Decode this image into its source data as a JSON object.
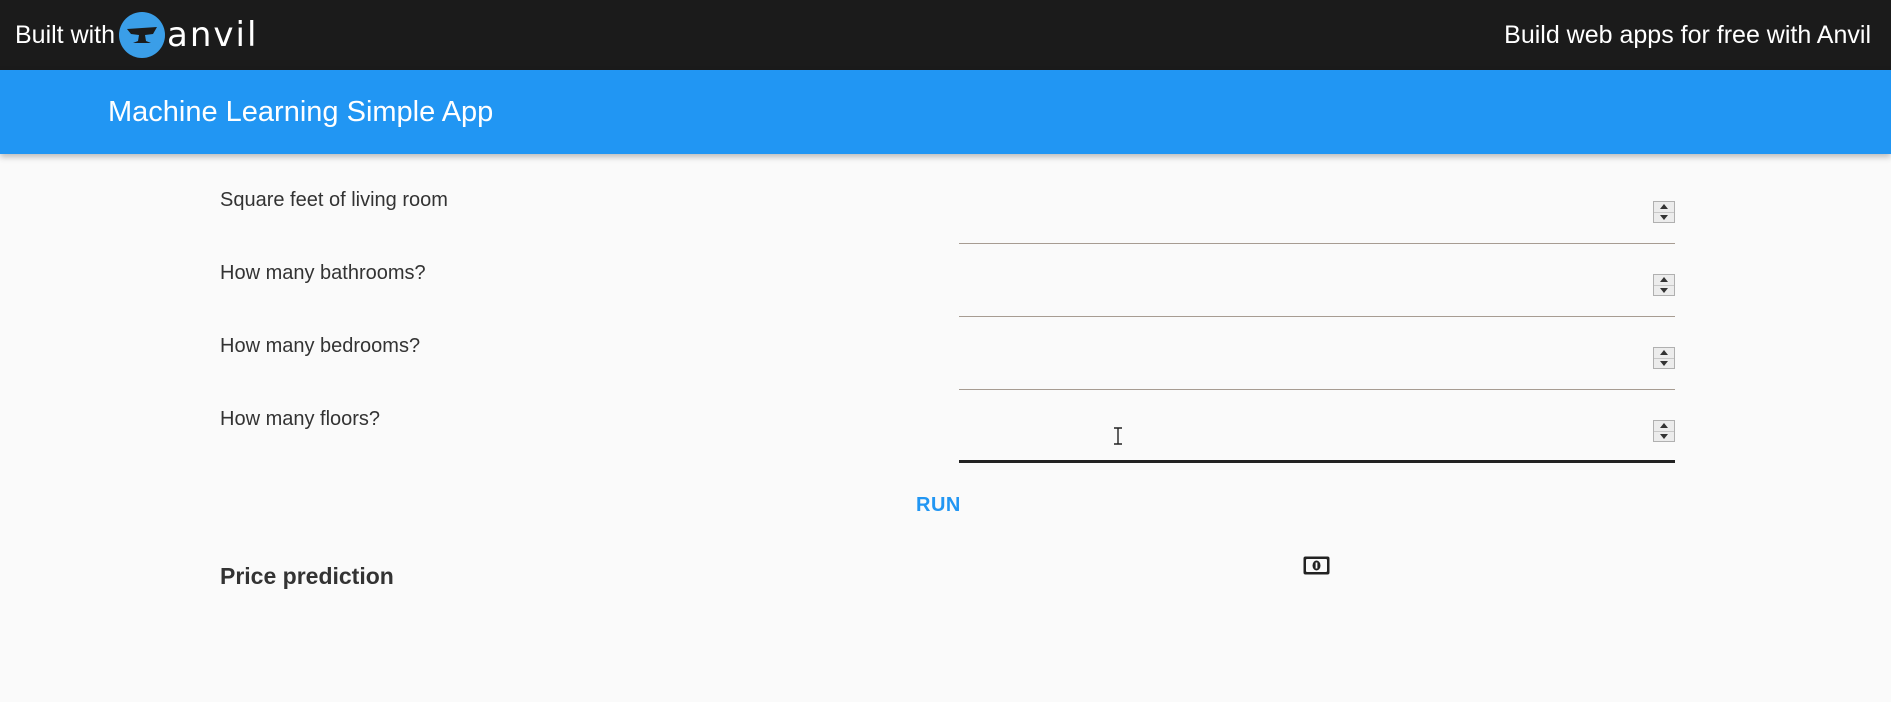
{
  "topbar": {
    "built_with": "Built with",
    "brand": "anvil",
    "promo": "Build web apps for free with Anvil",
    "bg_color": "#1b1b1b",
    "logo_color": "#3a9ee8"
  },
  "appbar": {
    "title": "Machine Learning Simple App",
    "bg_color": "#2196f3"
  },
  "form": {
    "fields": [
      {
        "label": "Square feet of living room",
        "value": "",
        "focused": false
      },
      {
        "label": "How many bathrooms?",
        "value": "",
        "focused": false
      },
      {
        "label": "How many bedrooms?",
        "value": "",
        "focused": false
      },
      {
        "label": "How many floors?",
        "value": "",
        "focused": true
      }
    ],
    "run_label": "RUN",
    "result_label": "Price prediction",
    "result_icon": "money-icon"
  },
  "icons": {
    "logo": "anvil-logo-icon",
    "spinner_up": "spinner-up-icon",
    "spinner_down": "spinner-down-icon",
    "cursor": "text-cursor-icon"
  }
}
